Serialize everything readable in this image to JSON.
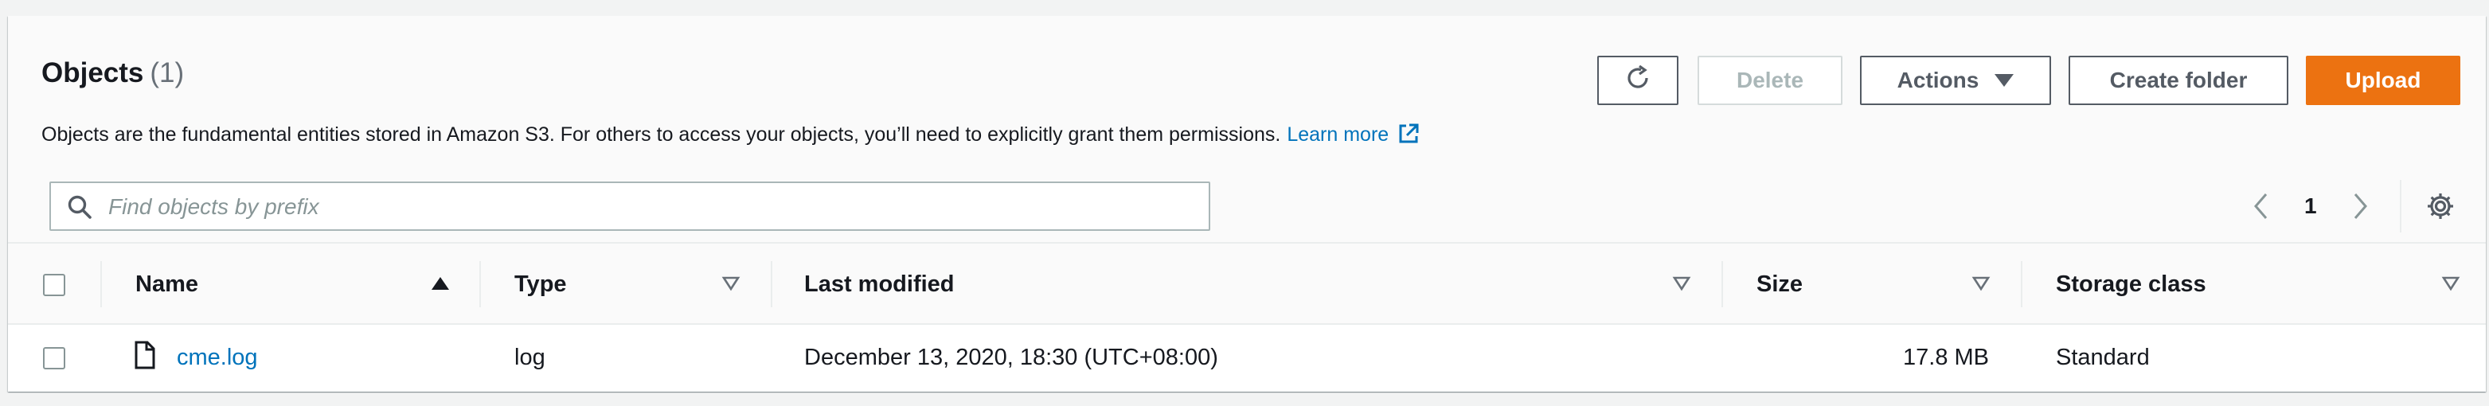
{
  "header": {
    "title": "Objects",
    "count": "(1)",
    "description": "Objects are the fundamental entities stored in Amazon S3. For others to access your objects, you’ll need to explicitly grant them permissions.",
    "learn_more": "Learn more"
  },
  "toolbar": {
    "refresh_icon": "refresh-icon",
    "delete_label": "Delete",
    "actions_label": "Actions",
    "create_folder_label": "Create folder",
    "upload_label": "Upload"
  },
  "search": {
    "placeholder": "Find objects by prefix",
    "value": ""
  },
  "pagination": {
    "current_page": "1"
  },
  "table": {
    "columns": [
      "Name",
      "Type",
      "Last modified",
      "Size",
      "Storage class"
    ],
    "rows": [
      {
        "name": "cme.log",
        "type": "log",
        "last_modified": "December 13, 2020, 18:30 (UTC+08:00)",
        "size": "17.8 MB",
        "storage_class": "Standard"
      }
    ]
  },
  "colors": {
    "primary_button": "#ec7211",
    "link": "#0073bb",
    "border": "#545b64",
    "disabled": "#aab7b8"
  }
}
